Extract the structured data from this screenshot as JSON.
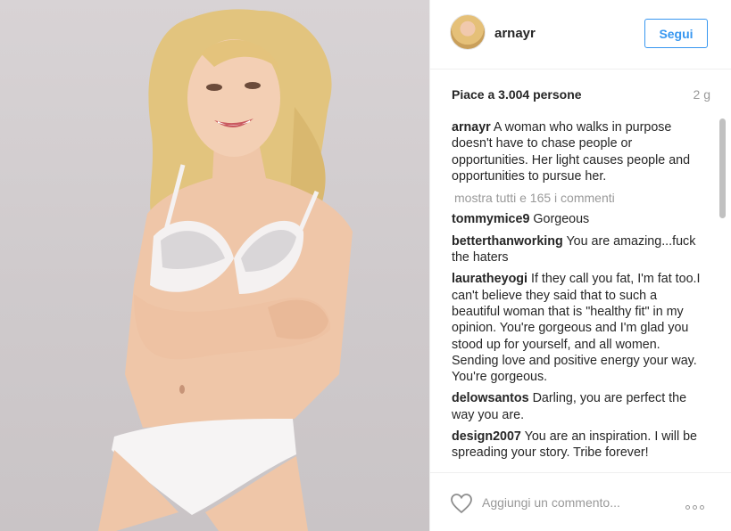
{
  "post": {
    "username": "arnayr",
    "follow_label": "Segui",
    "likes_text": "Piace a 3.004 persone",
    "time_ago": "2 g",
    "caption_user": "arnayr",
    "caption_text": "A woman who walks in purpose doesn't have to chase people or opportunities. Her light causes people and opportunities to pursue her.",
    "show_all_comments": "mostra tutti e 165 i commenti",
    "comments": [
      {
        "user": "tommymice9",
        "text": "Gorgeous"
      },
      {
        "user": "betterthanworking",
        "text": "You are amazing...fuck the haters"
      },
      {
        "user": "lauratheyogi",
        "text": "If they call you fat, I'm fat too.I can't believe they said that to such a beautiful woman that is \"healthy fit\" in my opinion. You're gorgeous and I'm glad you stood up for yourself, and all women. Sending love and positive energy your way. You're gorgeous."
      },
      {
        "user": "delowsantos",
        "text": "Darling, you are perfect the way you are."
      },
      {
        "user": "design2007",
        "text": "You are an inspiration. I will be spreading your story. Tribe forever!"
      }
    ],
    "comment_placeholder": "Aggiungi un commento...",
    "icons": {
      "like": "heart-icon",
      "more": "more-options-icon"
    }
  },
  "colors": {
    "accent": "#3897f0",
    "muted": "#999999",
    "text": "#262626"
  }
}
